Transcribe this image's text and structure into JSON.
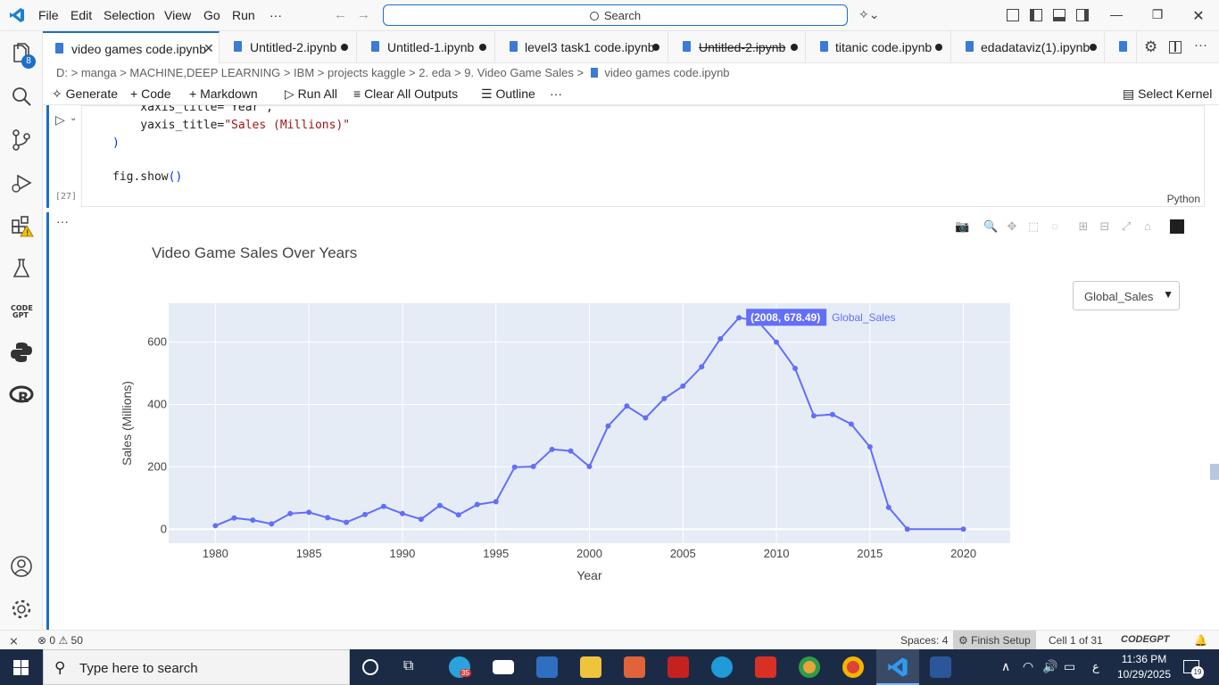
{
  "menu": {
    "file": "File",
    "edit": "Edit",
    "selection": "Selection",
    "view": "View",
    "go": "Go",
    "run": "Run",
    "more": "···"
  },
  "search": {
    "label": "Search"
  },
  "tabs": [
    {
      "label": "video games code.ipynb",
      "active": true
    },
    {
      "label": "Untitled-2.ipynb"
    },
    {
      "label": "Untitled-1.ipynb"
    },
    {
      "label": "level3 task1 code.ipynb"
    },
    {
      "label": "Untitled-2.ipynb",
      "strike": true
    },
    {
      "label": "titanic code.ipynb"
    },
    {
      "label": "edadataviz(1).ipynb"
    }
  ],
  "activity": {
    "badge": "8"
  },
  "breadcrumb": [
    "D:",
    "manga",
    "MACHINE,DEEP LEARNING",
    "IBM",
    "projects kaggle",
    "2. eda",
    "9. Video Game Sales",
    "video games code.ipynb"
  ],
  "toolbar": {
    "generate": "Generate",
    "code": "Code",
    "markdown": "Markdown",
    "run_all": "Run All",
    "clear": "Clear All Outputs",
    "outline": "Outline",
    "more": "···",
    "kernel": "Select Kernel"
  },
  "cell": {
    "line1": "    xaxis_title=\"Year\",",
    "line2_key": "    yaxis_title=",
    "line2_val": "\"Sales (Millions)\"",
    "line3": ")",
    "line4_a": "fig.show",
    "line4_b": "()",
    "exec_count": "[27]",
    "language": "Python"
  },
  "output": {
    "more": "···"
  },
  "chart_data": {
    "type": "line",
    "title": "Video Game Sales Over Years",
    "xlabel": "Year",
    "ylabel": "Sales (Millions)",
    "xlim": [
      1977.5,
      2022.5
    ],
    "ylim": [
      -45,
      725
    ],
    "xticks": [
      1980,
      1985,
      1990,
      1995,
      2000,
      2005,
      2010,
      2015,
      2020
    ],
    "yticks": [
      0,
      200,
      400,
      600
    ],
    "grid": true,
    "line_color": "#636efa",
    "plot_bg": "#e5ecf6",
    "series": [
      {
        "name": "Global_Sales",
        "x": [
          1980,
          1981,
          1982,
          1983,
          1984,
          1985,
          1986,
          1987,
          1988,
          1989,
          1990,
          1991,
          1992,
          1993,
          1994,
          1995,
          1996,
          1997,
          1998,
          1999,
          2000,
          2001,
          2002,
          2003,
          2004,
          2005,
          2006,
          2007,
          2008,
          2009,
          2010,
          2011,
          2012,
          2013,
          2014,
          2015,
          2016,
          2017,
          2020
        ],
        "y": [
          11,
          36,
          29,
          17,
          50,
          54,
          37,
          22,
          47,
          73,
          50,
          32,
          76,
          46,
          79,
          88,
          199,
          201,
          256,
          251,
          201,
          331,
          395,
          357,
          419,
          459,
          521,
          611,
          678.49,
          668,
          600,
          516,
          364,
          368,
          337,
          264,
          70,
          0,
          0
        ]
      }
    ],
    "tooltip": {
      "text": "(2008, 678.49)",
      "series_label": "Global_Sales"
    },
    "dropdown": {
      "selected": "Global_Sales"
    }
  },
  "status": {
    "errors": "0",
    "warnings": "50",
    "spaces": "Spaces: 4",
    "finish": "Finish Setup",
    "cell": "Cell 1 of 31",
    "codegpt": "CODEGPT"
  },
  "taskbar": {
    "search_placeholder": "Type here to search",
    "time": "11:36 PM",
    "date": "10/29/2025",
    "lang": "ع",
    "notif": "19",
    "telegram_badge": "35"
  }
}
